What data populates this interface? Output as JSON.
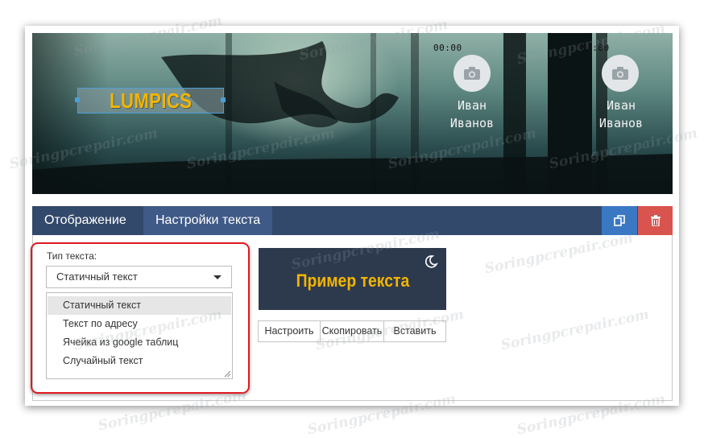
{
  "banner": {
    "logo_text": "LUMPICS",
    "profiles": [
      {
        "time": "00:00",
        "first_name": "Иван",
        "last_name": "Иванов"
      },
      {
        "time": "00:00",
        "first_name": "Иван",
        "last_name": "Иванов"
      }
    ]
  },
  "tabs": [
    {
      "label": "Отображение",
      "active": false
    },
    {
      "label": "Настройки текста",
      "active": true
    }
  ],
  "toolbar": {
    "copy_icon": "copy-icon",
    "delete_icon": "trash-icon",
    "copy_color": "#3b78c4",
    "delete_color": "#d9534f"
  },
  "text_type": {
    "label": "Тип текста:",
    "selected": "Статичный текст",
    "options": [
      "Статичный текст",
      "Текст по адресу",
      "Ячейка из google таблиц",
      "Случайный текст"
    ]
  },
  "preview": {
    "text": "Пример текста",
    "theme_icon": "moon-icon"
  },
  "actions": {
    "configure": "Настроить",
    "copy": "Скопировать",
    "paste": "Вставить"
  },
  "watermark": "Soringpcrepair.com",
  "colors": {
    "accent_gold": "#f4b400",
    "tabbar": "#33496b",
    "highlight_red": "#e0191f"
  }
}
